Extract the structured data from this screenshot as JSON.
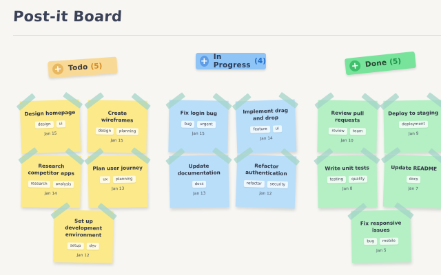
{
  "page": {
    "title": "Post-it Board"
  },
  "colors": {
    "todo_header": "#f9d996",
    "todo_accent": "#e8b860",
    "todo_count": "#d68a1e",
    "progress_header": "#8fc4f7",
    "progress_accent": "#5e9de6",
    "progress_count": "#1f6fcf",
    "done_header": "#77e39b",
    "done_accent": "#3fc06c",
    "done_count": "#1b8f45",
    "note_yellow": "#fbe98a",
    "note_blue": "#b9def9",
    "note_green": "#b4f0c4"
  },
  "columns": {
    "todo": {
      "label": "Todo",
      "count": "(5)",
      "notes": [
        {
          "title": "Design homepage",
          "tags": [
            "design",
            "ui"
          ],
          "date": "Jan 15"
        },
        {
          "title": "Create wireframes",
          "tags": [
            "design",
            "planning"
          ],
          "date": "Jan 15"
        },
        {
          "title": "Research competitor apps",
          "tags": [
            "research",
            "analysis"
          ],
          "date": "Jan 14"
        },
        {
          "title": "Plan user journey",
          "tags": [
            "ux",
            "planning"
          ],
          "date": "Jan 13"
        },
        {
          "title": "Set up development environment",
          "tags": [
            "setup",
            "dev"
          ],
          "date": "Jan 12"
        }
      ]
    },
    "in_progress": {
      "label": "In Progress",
      "count": "(4)",
      "notes": [
        {
          "title": "Fix login bug",
          "tags": [
            "bug",
            "urgent"
          ],
          "date": "Jan 15"
        },
        {
          "title": "Implement drag and drop",
          "tags": [
            "feature",
            "ui"
          ],
          "date": "Jan 14"
        },
        {
          "title": "Update documentation",
          "tags": [
            "docs"
          ],
          "date": "Jan 13"
        },
        {
          "title": "Refactor authentication",
          "tags": [
            "refactor",
            "security"
          ],
          "date": "Jan 12"
        }
      ]
    },
    "done": {
      "label": "Done",
      "count": "(5)",
      "notes": [
        {
          "title": "Review pull requests",
          "tags": [
            "review",
            "team"
          ],
          "date": "Jan 10"
        },
        {
          "title": "Deploy to staging",
          "tags": [
            "deployment"
          ],
          "date": "Jan 9"
        },
        {
          "title": "Write unit tests",
          "tags": [
            "testing",
            "quality"
          ],
          "date": "Jan 8"
        },
        {
          "title": "Update README",
          "tags": [
            "docs"
          ],
          "date": "Jan 7"
        },
        {
          "title": "Fix responsive issues",
          "tags": [
            "bug",
            "mobile"
          ],
          "date": "Jan 5"
        }
      ]
    }
  }
}
